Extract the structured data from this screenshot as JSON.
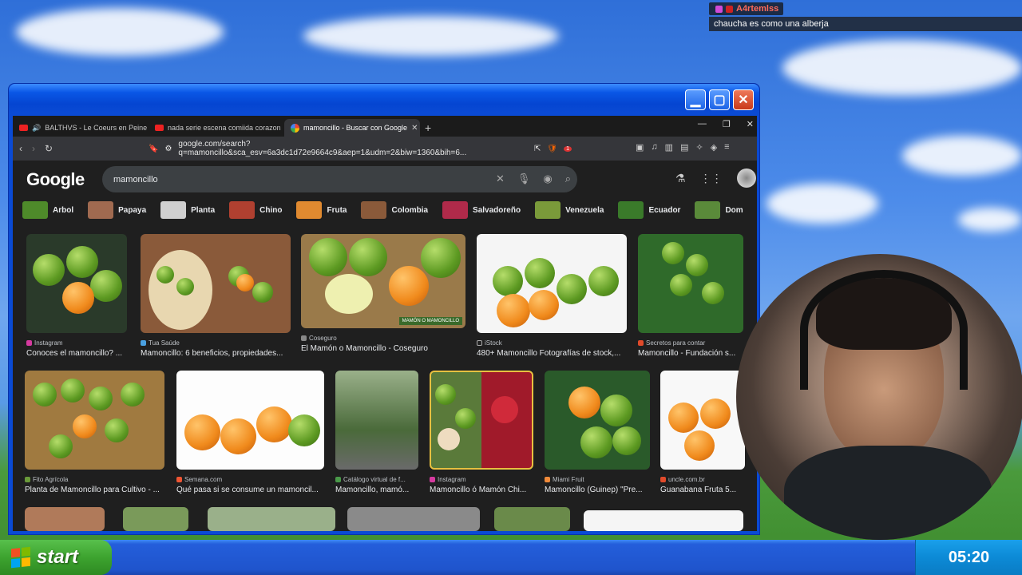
{
  "chat": {
    "username": "A4rtemlss",
    "message": "chaucha es como una alberja"
  },
  "browser": {
    "tabs": [
      {
        "label": "BALTHVS - Le Coeurs en Peine (A",
        "icon": "youtube-icon"
      },
      {
        "label": "nada serie escena comiida corazon",
        "icon": "youtube-icon"
      },
      {
        "label": "mamoncillo - Buscar con Google",
        "icon": "google-icon",
        "active": true
      }
    ],
    "url": "google.com/search?q=mamoncillo&sca_esv=6a3dc1d72e9664c9&aep=1&udm=2&biw=1360&bih=6...",
    "shield_badge": "1"
  },
  "google": {
    "logo": "Google",
    "query": "mamoncillo",
    "chips": [
      "Arbol",
      "Papaya",
      "Planta",
      "Chino",
      "Fruta",
      "Colombia",
      "Salvadoreño",
      "Venezuela",
      "Ecuador",
      "Dom"
    ],
    "row1": [
      {
        "source": "Instagram",
        "title": "Conoces el mamoncillo? ..."
      },
      {
        "source": "Tua Saúde",
        "title": "Mamoncillo: 6 beneficios, propiedades..."
      },
      {
        "source": "Coseguro",
        "title": "El Mamón o Mamoncillo - Coseguro",
        "overlay": "MAMÓN O MAMONCILLO"
      },
      {
        "source": "iStock",
        "title": "480+ Mamoncillo Fotografías de stock,..."
      },
      {
        "source": "Secretos para contar",
        "title": "Mamoncillo - Fundación s..."
      }
    ],
    "row2": [
      {
        "source": "Fito Agrícola",
        "title": "Planta de Mamoncillo para Cultivo - ..."
      },
      {
        "source": "Semana.com",
        "title": "Qué pasa si se consume un mamoncil..."
      },
      {
        "source": "Catálogo virtual de f...",
        "title": "Mamoncillo, mamó..."
      },
      {
        "source": "Instagram",
        "title": "Mamoncillo ó Mamón Chi..."
      },
      {
        "source": "Miami Fruit",
        "title": "Mamoncillo (Guinep) \"Pre..."
      },
      {
        "source": "uncle.com.br",
        "title": "Guanabana Fruta 5..."
      }
    ]
  },
  "taskbar": {
    "start_label": "start",
    "clock": "05:20"
  },
  "colors": {
    "xp_blue": "#0a4ad4",
    "start_green": "#3da32f",
    "dark_bg": "#1f1f1f"
  }
}
